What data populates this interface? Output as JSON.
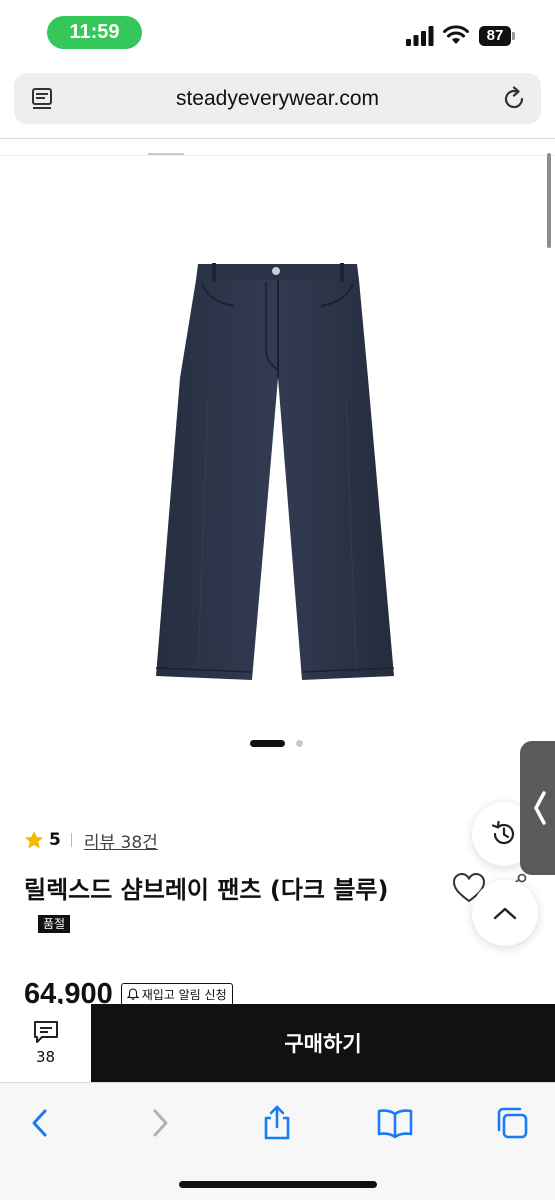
{
  "status_bar": {
    "time": "11:59",
    "battery": "87"
  },
  "browser": {
    "url": "steadyeverywear.com"
  },
  "product": {
    "rating": "5",
    "review_link": "리뷰 38건",
    "title": "릴렉스드 샴브레이 팬츠 (다크 블루)",
    "soldout_badge": "품절",
    "price": "64,900",
    "restock_button": "재입고 알림 신청",
    "carousel": {
      "current": 1,
      "total": 2
    }
  },
  "purchase_bar": {
    "review_count": "38",
    "buy_label": "구매하기"
  },
  "icons": {
    "reader": "reader-mode-icon",
    "reload": "reload-icon",
    "star": "star-icon",
    "wish": "heart-icon",
    "share": "share-icon",
    "history": "history-icon",
    "scroll_top": "chevron-up-icon",
    "side_tab": "chevron-left-icon",
    "chat": "chat-icon",
    "back": "back-icon",
    "forward": "forward-icon",
    "share_sheet": "share-sheet-icon",
    "bookmarks": "bookmarks-icon",
    "tabs": "tabs-icon"
  },
  "colors": {
    "status_pill": "#34c759",
    "buy_button": "#111111",
    "star": "#f5b700",
    "ios_blue": "#1a7cf4",
    "denim": "#2a3244"
  }
}
